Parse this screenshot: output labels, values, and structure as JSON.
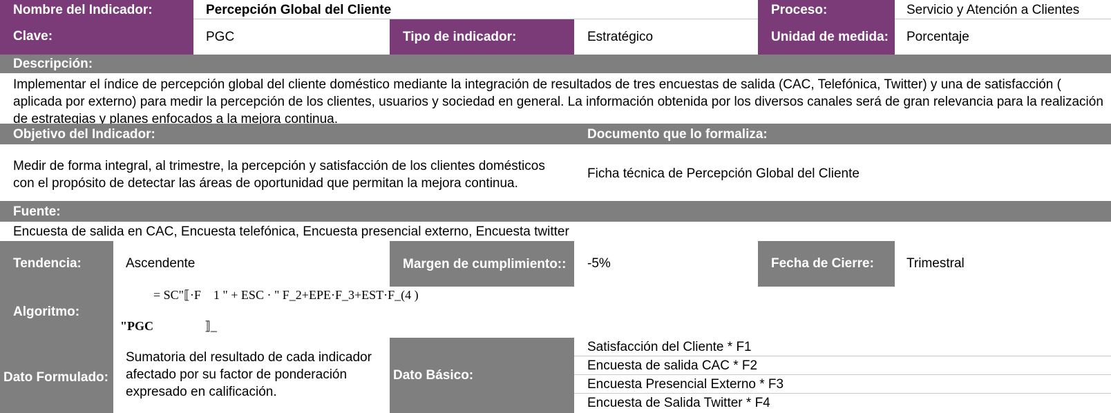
{
  "header": {
    "nombre_label": "Nombre del Indicador:",
    "nombre_value": "Percepción Global del Cliente",
    "proceso_label": "Proceso:",
    "proceso_value": "Servicio y Atención a Clientes",
    "clave_label": "Clave:",
    "clave_value": "PGC",
    "tipo_label": "Tipo de indicador:",
    "tipo_value": "Estratégico",
    "unidad_label": "Unidad de medida:",
    "unidad_value": "Porcentaje"
  },
  "descripcion": {
    "label": "Descripción:",
    "text": "Implementar el índice de percepción global del cliente doméstico mediante la integración de resultados de tres encuestas de salida (CAC, Telefónica, Twitter)  y una de satisfacción ( aplicada por externo)  para medir la percepción de los clientes, usuarios y sociedad en general. La información obtenida por los diversos canales será de gran relevancia para la realización de estrategias y planes enfocados a la mejora continua."
  },
  "objetivo": {
    "label": "Objetivo del Indicador:",
    "text": "Medir de forma integral, al trimestre, la percepción y satisfacción de los clientes domésticos con el propósito de detectar las áreas de oportunidad que permitan la mejora continua.",
    "documento_label": "Documento que lo formaliza:",
    "documento_value": "Ficha técnica de Percepción Global del Cliente"
  },
  "fuente": {
    "label": "Fuente:",
    "text": "Encuesta de salida en CAC, Encuesta telefónica, Encuesta presencial externo, Encuesta twitter"
  },
  "tendencia": {
    "label": "Tendencia:",
    "value": "Ascendente",
    "margen_label": "Margen de cumplimiento::",
    "margen_value": "-5%",
    "fecha_label": "Fecha de Cierre:",
    "fecha_value": "Trimestral"
  },
  "algoritmo": {
    "label": "Algoritmo:",
    "formula_line1": "= SC\"⟦·F    1 \" + ESC · \" F_2+EPE·F_3+EST·F_(4 )",
    "formula_line2_a": "\"PGC",
    "formula_line2_b": "⟧_"
  },
  "dato": {
    "formulado_label": "Dato Formulado:",
    "formulado_text": "Sumatoria del resultado de cada indicador afectado por su factor de ponderación expresado en calificación.",
    "basico_label": "Dato Básico:",
    "basico_items": [
      "Satisfacción del Cliente * F1",
      "Encuesta de salida CAC * F2",
      "Encuesta Presencial Externo * F3",
      "Encuesta de Salida Twitter * F4"
    ]
  }
}
